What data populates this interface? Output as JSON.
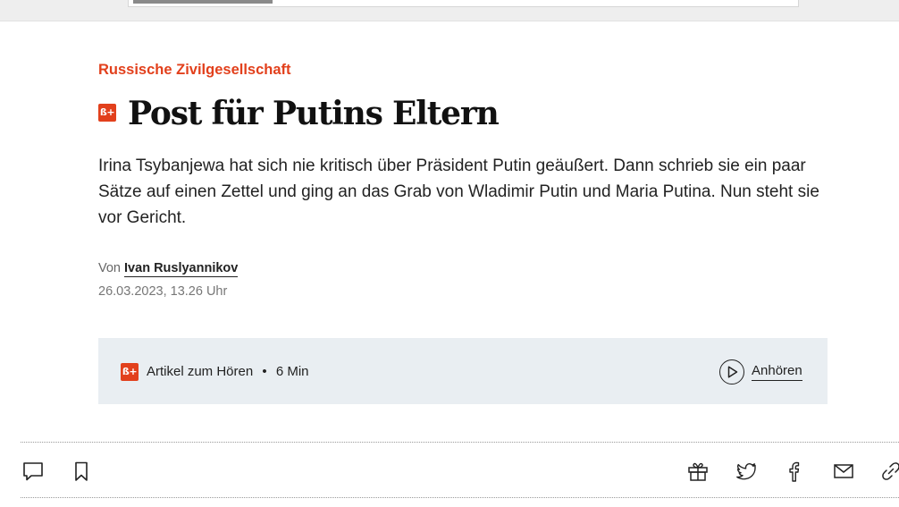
{
  "kicker": "Russische Zivilgesellschaft",
  "premium_badge": "ß+",
  "headline": "Post für Putins Eltern",
  "teaser": "Irina Tsybanjewa hat sich nie kritisch über Präsident Putin geäußert. Dann schrieb sie ein paar Sätze auf einen Zettel und ging an das Grab von Wladimir Putin und Maria Putina. Nun steht sie vor Gericht.",
  "byline": {
    "prefix": "Von",
    "author": "Ivan Ruslyannikov"
  },
  "date": "26.03.2023, 13.26 Uhr",
  "audio": {
    "label": "Artikel zum Hören",
    "separator": "•",
    "duration": "6 Min",
    "listen_label": "Anhören"
  },
  "colors": {
    "accent": "#e2401c",
    "audio_bg": "#e9eef2"
  },
  "toolbar": {
    "left": [
      "comment-icon",
      "bookmark-icon"
    ],
    "right": [
      "gift-icon",
      "twitter-icon",
      "facebook-icon",
      "mail-icon",
      "link-icon"
    ]
  }
}
